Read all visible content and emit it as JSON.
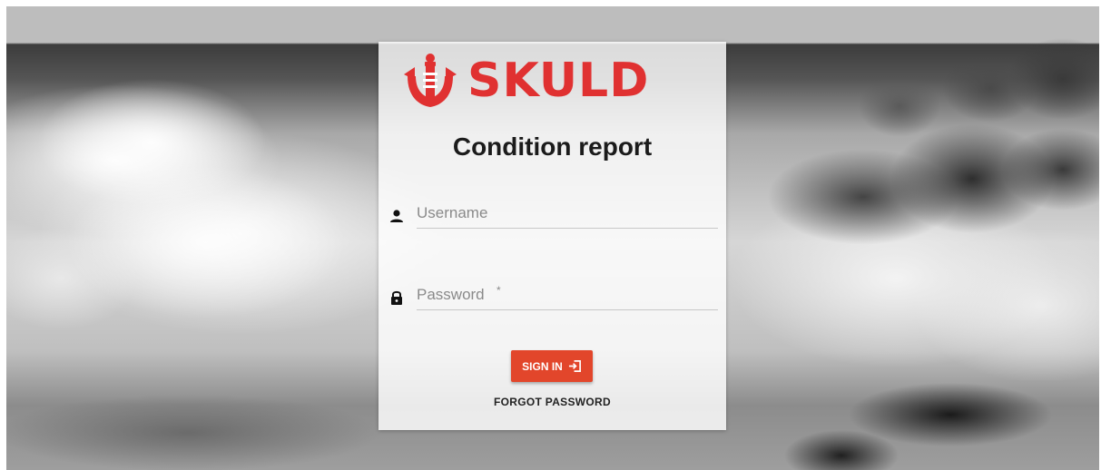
{
  "brand": {
    "name": "SKULD",
    "color": "#e03131",
    "logo_icon": "anchor-shield-icon"
  },
  "page": {
    "title": "Condition report"
  },
  "form": {
    "username": {
      "placeholder": "Username",
      "icon": "person-icon"
    },
    "password": {
      "placeholder": "Password",
      "required_mark": "*",
      "icon": "lock-icon"
    },
    "submit": {
      "label": "SIGN IN",
      "icon": "sign-in-icon",
      "color": "#e2462b"
    },
    "forgot_label": "FORGOT PASSWORD"
  }
}
